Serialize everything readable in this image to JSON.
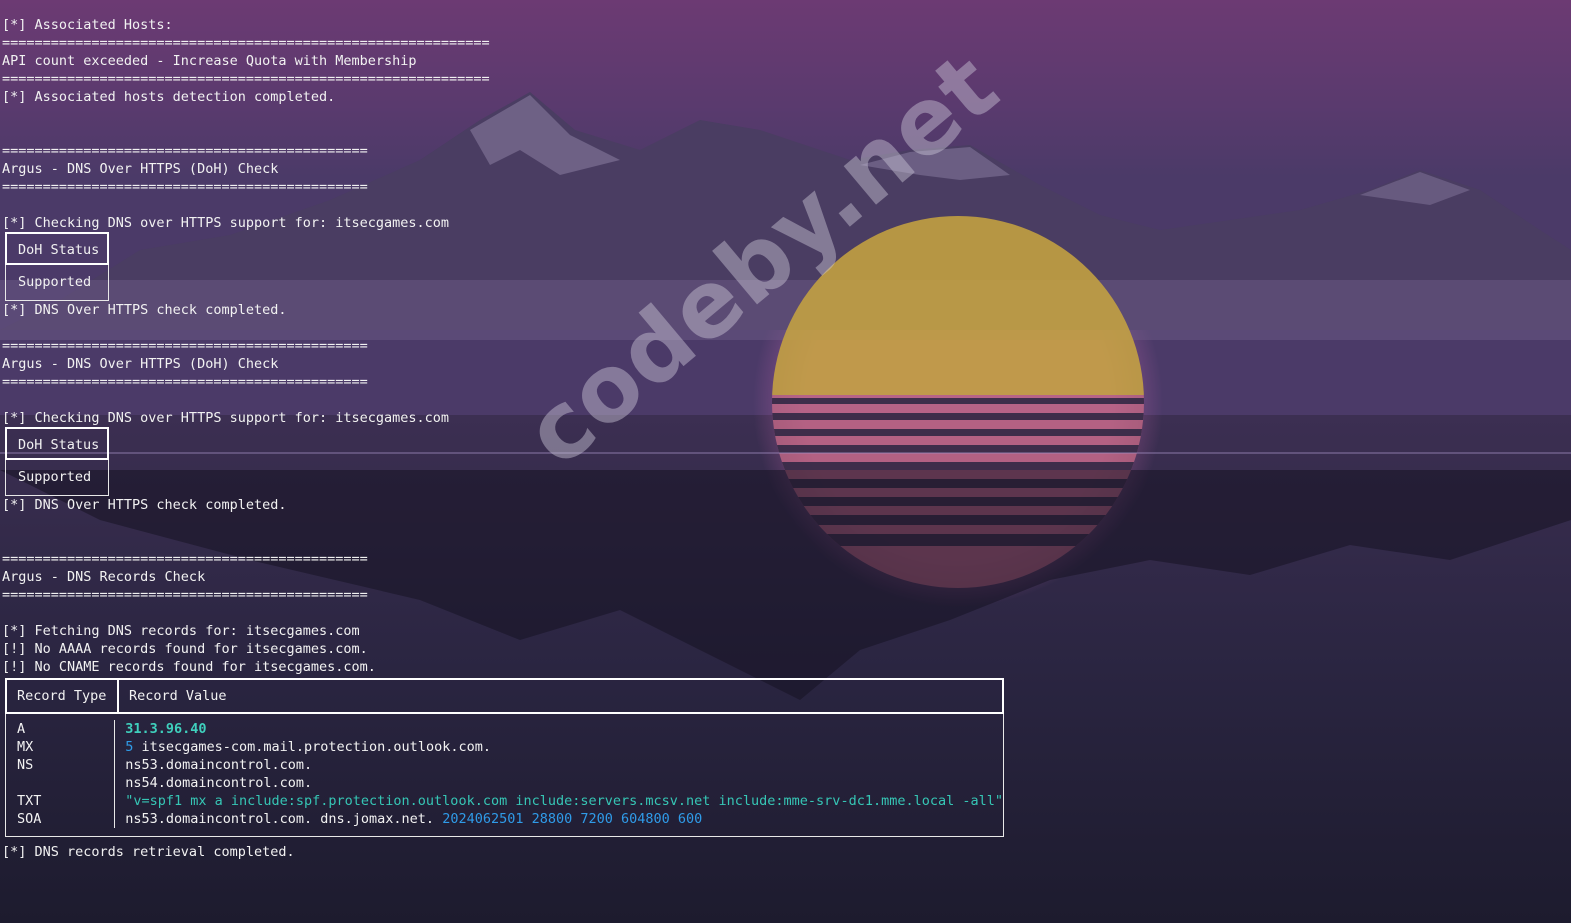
{
  "watermark": "codeby.net",
  "colors": {
    "text": "#f2f2f2",
    "ip": "#3fd0bd",
    "txt_value": "#36c6b5",
    "numbers": "#2f9be8",
    "sun": "#c9a640",
    "sky": "#6c3a73"
  },
  "lines": {
    "assoc_header": "[*] Associated Hosts:",
    "sep_long": "============================================================",
    "api_msg": "API count exceeded - Increase Quota with Membership",
    "assoc_done": "[*] Associated hosts detection completed.",
    "sep_short": "=============================================",
    "doh_title": "Argus - DNS Over HTTPS (DoH) Check",
    "doh_checking": "[*] Checking DNS over HTTPS support for: itsecgames.com",
    "doh_done": "[*] DNS Over HTTPS check completed.",
    "dns_title": "Argus - DNS Records Check",
    "dns_fetching": "[*] Fetching DNS records for: itsecgames.com",
    "no_aaaa": "[!] No AAAA records found for itsecgames.com.",
    "no_cname": "[!] No CNAME records found for itsecgames.com.",
    "dns_done": "[*] DNS records retrieval completed."
  },
  "doh_table": {
    "header": "DoH Status",
    "value": "Supported"
  },
  "dns_table": {
    "headers": [
      "Record Type",
      "Record Value"
    ],
    "types": [
      "A",
      "MX",
      "NS",
      "",
      "TXT",
      "SOA"
    ],
    "a_value": "31.3.96.40",
    "mx_pref": "5",
    "mx_host": " itsecgames-com.mail.protection.outlook.com.",
    "ns1": "ns53.domaincontrol.com.",
    "ns2": "ns54.domaincontrol.com.",
    "txt_value": "\"v=spf1 mx a include:spf.protection.outlook.com include:servers.mcsv.net include:mme-srv-dc1.mme.local -all\"",
    "soa_names": "ns53.domaincontrol.com. dns.jomax.net. ",
    "soa_numbers": "2024062501 28800 7200 604800 600"
  }
}
